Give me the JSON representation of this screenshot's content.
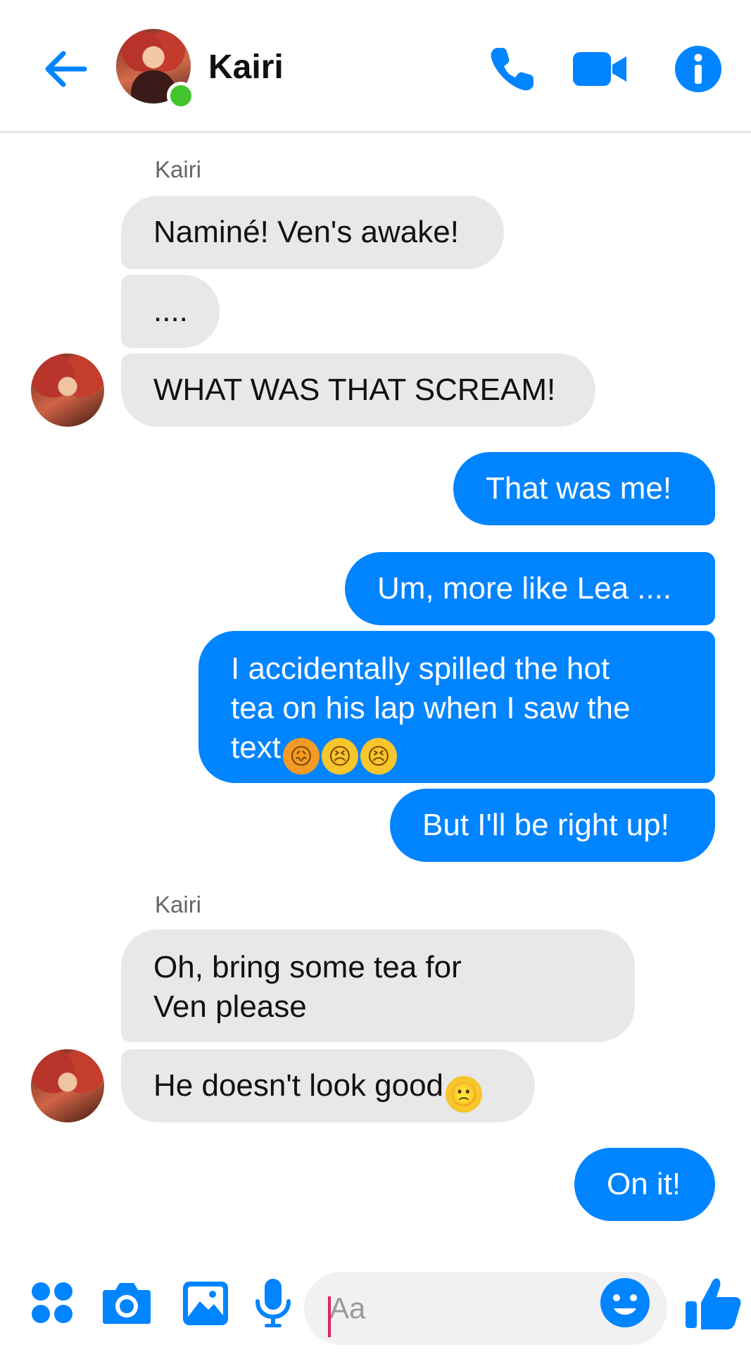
{
  "header": {
    "contact_name": "Kairi",
    "icons": [
      "back-arrow-icon",
      "phone-icon",
      "video-camera-icon",
      "info-icon"
    ]
  },
  "colors": {
    "accent": "#0084ff",
    "online": "#44c42c",
    "incoming_bubble": "#e8e8e8"
  },
  "messages": {
    "group1_sender": "Kairi",
    "m1": "Naminé! Ven's awake!",
    "m2": "....",
    "m3": "WHAT WAS THAT SCREAM!",
    "m4": "That was me!",
    "m5": "Um, more like Lea ....",
    "m6_line1": "I accidentally spilled the hot",
    "m6_line2": "tea on his lap when I saw the",
    "m6_line3": "text",
    "m6_emojis": [
      "😖",
      "😣",
      "😣"
    ],
    "m7": "But I'll be right up!",
    "group2_sender": "Kairi",
    "m8_line1": "Oh, bring some tea for",
    "m8_line2": "Ven please",
    "m9": "He doesn't look good",
    "m9_emoji": "🙁",
    "m10": "On it!"
  },
  "composer": {
    "placeholder": "Aa",
    "icons": [
      "apps-grid-icon",
      "camera-icon",
      "image-icon",
      "microphone-icon",
      "emoji-icon",
      "thumbs-up-icon"
    ]
  }
}
